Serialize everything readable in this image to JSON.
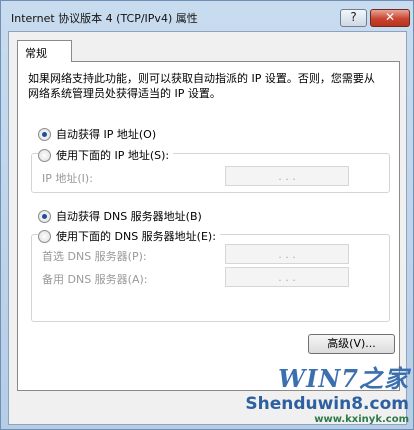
{
  "window": {
    "title": "Internet 协议版本 4 (TCP/IPv4) 属性",
    "help_label": "?",
    "close_label": "✕"
  },
  "tabs": [
    {
      "label": "常规"
    }
  ],
  "general": {
    "description": "如果网络支持此功能，则可以获取自动指派的 IP 设置。否则，您需要从网络系统管理员处获得适当的 IP 设置。",
    "ip": {
      "auto_label": "自动获得 IP 地址(O)",
      "manual_label": "使用下面的 IP 地址(S):",
      "address_label": "IP 地址(I):",
      "selected": "auto"
    },
    "dns": {
      "auto_label": "自动获得 DNS 服务器地址(B)",
      "manual_label": "使用下面的 DNS 服务器地址(E):",
      "preferred_label": "首选 DNS 服务器(P):",
      "alternate_label": "备用 DNS 服务器(A):",
      "selected": "auto"
    },
    "ip_dots": ".   .   .",
    "advanced_label": "高级(V)..."
  },
  "watermark": {
    "logo_text": "WIN7之家",
    "site_text": "Shenduwin8.com",
    "sub_text": "www.kxinyk.com"
  },
  "colors": {
    "radio_dot": "#1f4e9a",
    "disabled_text": "#9a9a9a",
    "close_button": "#c8452f"
  }
}
